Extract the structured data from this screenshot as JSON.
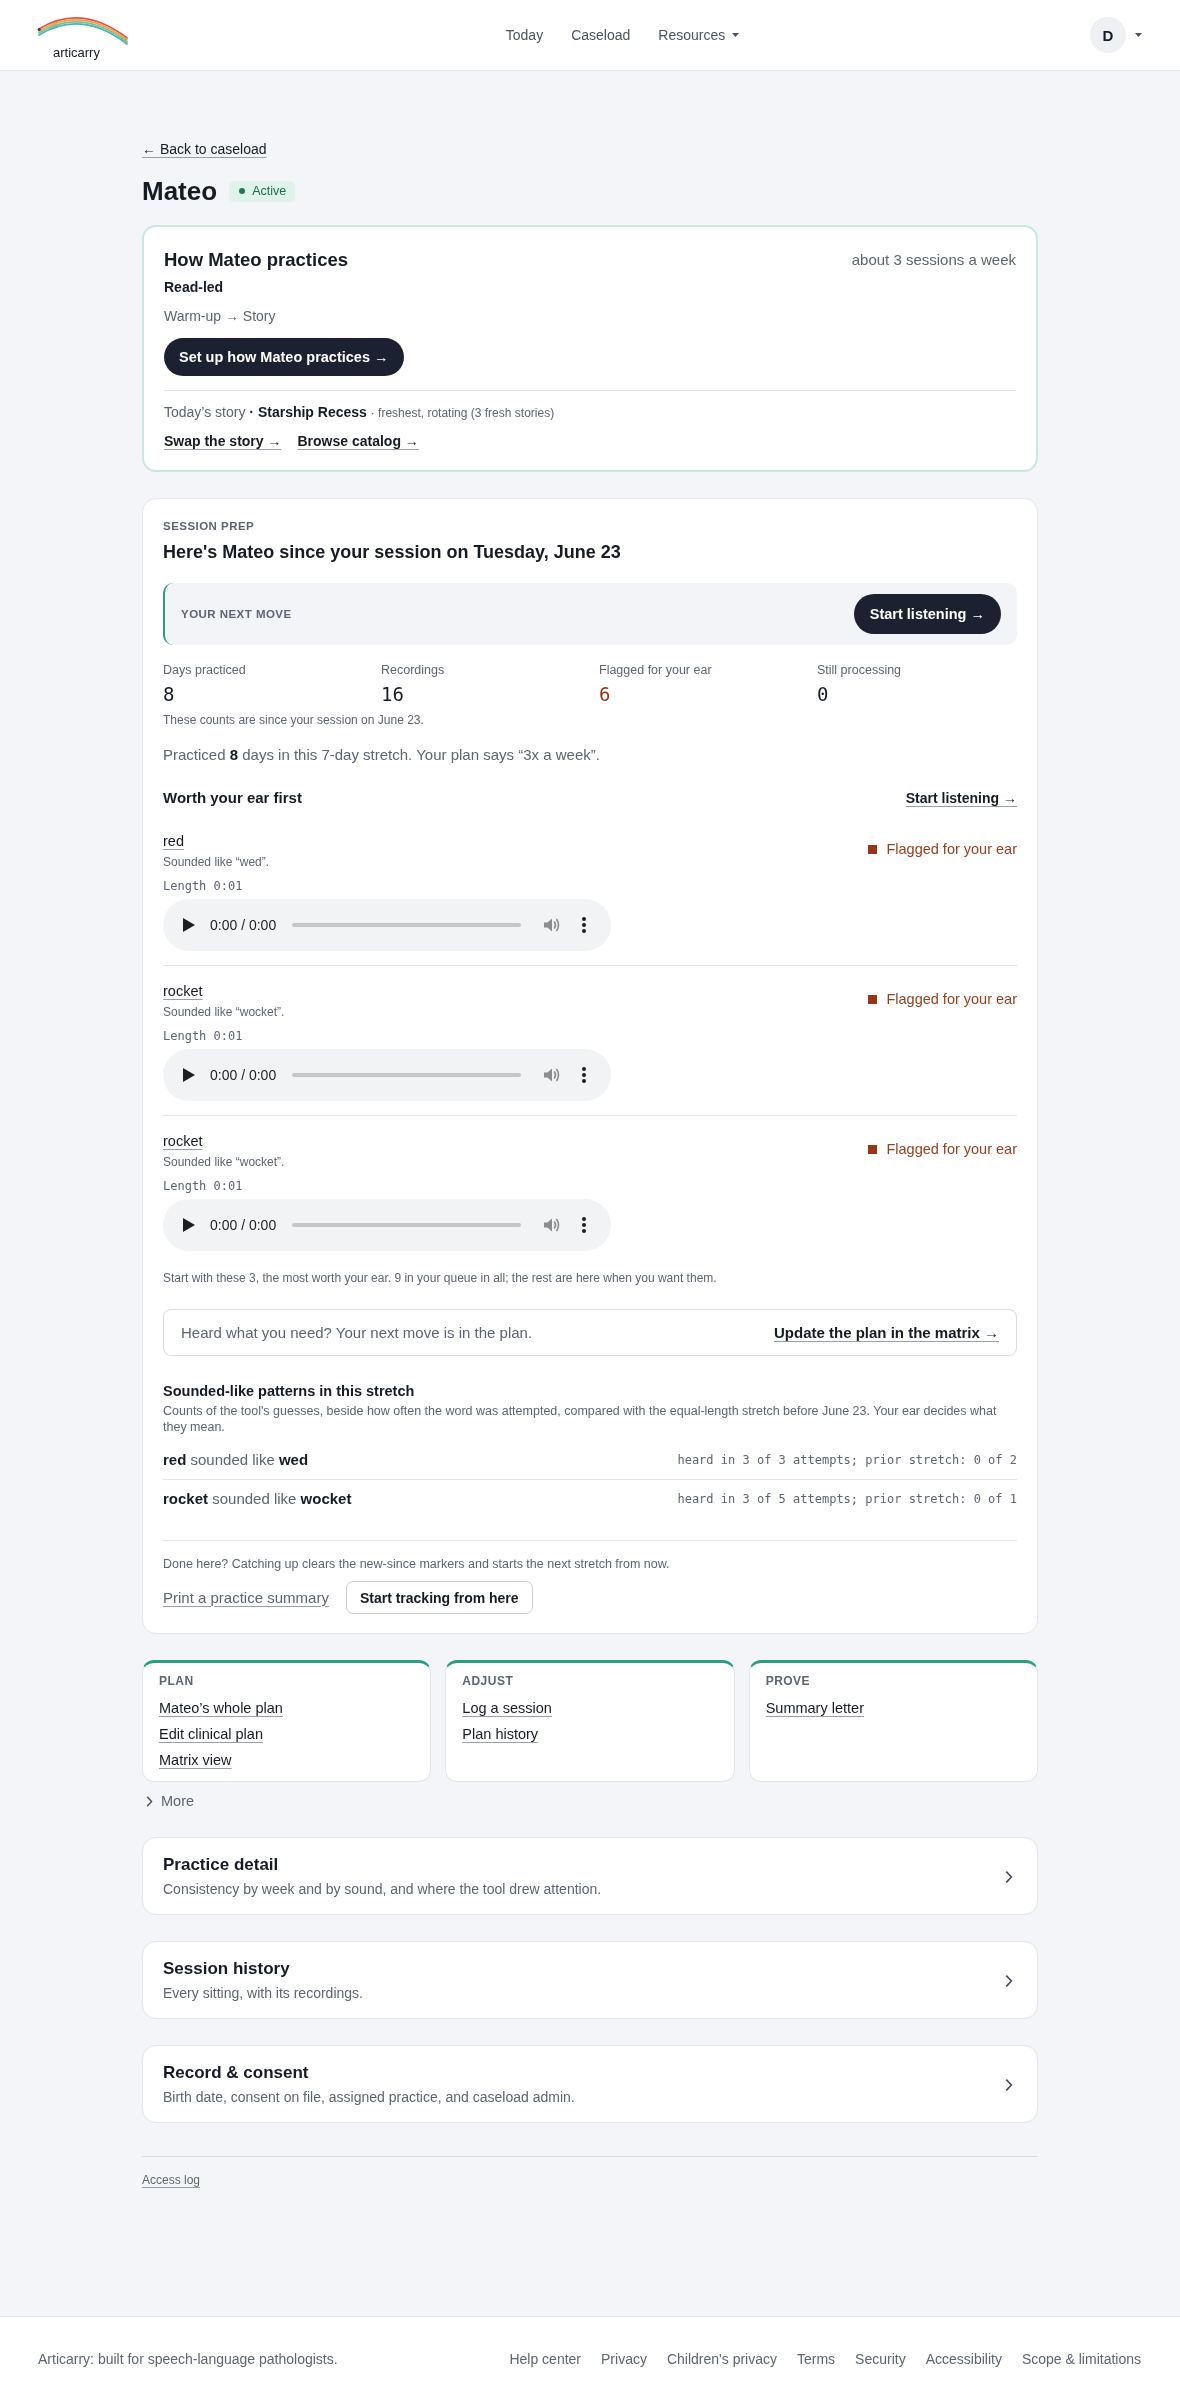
{
  "header": {
    "logo": "articarry",
    "nav": [
      {
        "label": "Today",
        "kind": "link"
      },
      {
        "label": "Caseload",
        "kind": "link"
      },
      {
        "label": "Resources",
        "kind": "dropdown"
      }
    ],
    "account": {
      "initial": "D"
    }
  },
  "back_link": "← Back to caseload",
  "client": {
    "name": "Mateo",
    "status": {
      "label": "Active",
      "kind": "active"
    }
  },
  "practice": {
    "title": "How Mateo practices",
    "frequency": "about 3 sessions a week",
    "mode": "Read-led",
    "flow": "Warm-up → Story",
    "button": "Set up how Mateo practices →",
    "story": {
      "label": "Today’s story",
      "title": "· Starship Recess",
      "note": "· freshest, rotating (3 fresh stories)"
    },
    "links": [
      "Swap the story →",
      "Browse catalog →"
    ]
  },
  "session_prep": {
    "eyebrow": "SESSION PREP",
    "heading": "Here's Mateo since your session on Tuesday, June 23",
    "next_move": {
      "label": "YOUR NEXT MOVE",
      "button": "Start listening →"
    },
    "stats": [
      {
        "label": "Days practiced",
        "value": "8",
        "kind": "count"
      },
      {
        "label": "Recordings",
        "value": "16",
        "kind": "count"
      },
      {
        "label": "Flagged for your ear",
        "value": "6",
        "kind": "flag"
      },
      {
        "label": "Still processing",
        "value": "0",
        "kind": "count"
      }
    ],
    "stats_note": "These counts are since your session on June 23.",
    "summary": "Practiced **8** days in this 7-day stretch. Your plan says “3x a week”.",
    "queue": {
      "title": "Worth your ear first",
      "link": "Start listening →",
      "items": [
        {
          "word": "red",
          "note": "Sounded like “wed”.",
          "length": "Length 0:01",
          "flagged": true,
          "flag": "Flagged for your ear",
          "player": {
            "time": "0:00 / 0:00",
            "level": 0
          }
        },
        {
          "word": "rocket",
          "note": "Sounded like “wocket”.",
          "length": "Length 0:01",
          "flagged": true,
          "flag": "Flagged for your ear",
          "player": {
            "time": "0:00 / 0:00",
            "level": 0
          }
        },
        {
          "word": "rocket",
          "note": "Sounded like “wocket”.",
          "length": "Length 0:01",
          "flagged": true,
          "flag": "Flagged for your ear",
          "player": {
            "time": "0:00 / 0:00",
            "level": 0
          }
        }
      ]
    },
    "queue_note": "Start with these 3, the most worth your ear. 9 in your queue in all; the rest are here when you want them.",
    "callout": {
      "text": "Heard what you need? Your next move is in the plan.",
      "link": "Update the plan in the matrix →"
    },
    "patterns": {
      "title": "Sounded-like patterns in this stretch",
      "description": "Counts of the tool's guesses, beside how often the word was attempted, compared with the equal-length stretch before June 23. Your ear decides what they mean.",
      "rows": [
        {
          "text": "**red** sounded like **wed**",
          "counts": "heard in 3 of 3 attempts; prior stretch: 0 of 2"
        },
        {
          "text": "**rocket** sounded like **wocket**",
          "counts": "heard in 3 of 5 attempts; prior stretch: 0 of 1"
        }
      ]
    },
    "wrap_up": {
      "note": "Done here? Catching up clears the new-since markers and starts the next stretch from now.",
      "link": "Print a practice summary",
      "button": "Start tracking from here"
    }
  },
  "shortcuts": [
    {
      "label": "PLAN",
      "links": [
        "Mateo’s whole plan",
        "Edit clinical plan",
        "Matrix view"
      ]
    },
    {
      "label": "ADJUST",
      "links": [
        "Log a session",
        "Plan history"
      ]
    },
    {
      "label": "PROVE",
      "links": [
        "Summary letter"
      ]
    }
  ],
  "more": {
    "label": "More",
    "expanded": false
  },
  "sections": [
    {
      "title": "Practice detail",
      "description": "Consistency by week and by sound, and where the tool drew attention."
    },
    {
      "title": "Session history",
      "description": "Every sitting, with its recordings."
    },
    {
      "title": "Record & consent",
      "description": "Birth date, consent on file, assigned practice, and caseload admin."
    }
  ],
  "access_log": "Access log",
  "footer": {
    "tagline": "Articarry: built for speech-language pathologists.",
    "links": [
      "Help center",
      "Privacy",
      "Children's privacy",
      "Terms",
      "Security",
      "Accessibility",
      "Scope & limitations"
    ]
  }
}
